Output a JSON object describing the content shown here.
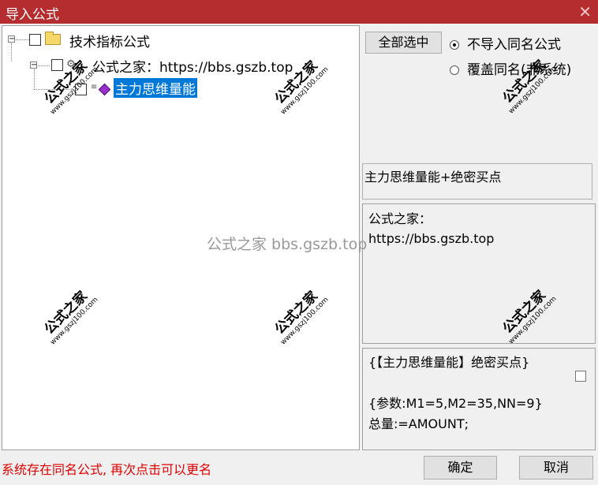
{
  "window": {
    "title": "导入公式",
    "close_glyph": "✕"
  },
  "tree": {
    "root": {
      "label": "技术指标公式",
      "expander": "−"
    },
    "child": {
      "label": "公式之家：https://bbs.gszb.top",
      "expander": "−"
    },
    "leaf": {
      "label": "主力思维量能"
    }
  },
  "buttons": {
    "select_all": "全部选中",
    "ok": "确定",
    "cancel": "取消"
  },
  "options": [
    {
      "label": "不导入同名公式",
      "selected": true
    },
    {
      "label": "覆盖同名(非系统)",
      "selected": false
    }
  ],
  "formula_name": "主力思维量能+绝密买点",
  "description_lines": [
    "公式之家：",
    "https://bbs.gszb.top"
  ],
  "code_lines": [
    "{【主力思维量能】绝密买点}",
    "",
    "{参数:M1=5,M2=35,NN=9}",
    "总量:=AMOUNT;"
  ],
  "status_text": "系统存在同名公式, 再次点击可以更名",
  "watermark": {
    "line1": "公式之家",
    "line2": "www.gszj100.com",
    "center": "公式之家 bbs.gszb.top"
  },
  "colors": {
    "titlebar": "#b52d2f",
    "selection": "#0078d7",
    "status": "#e00000"
  }
}
